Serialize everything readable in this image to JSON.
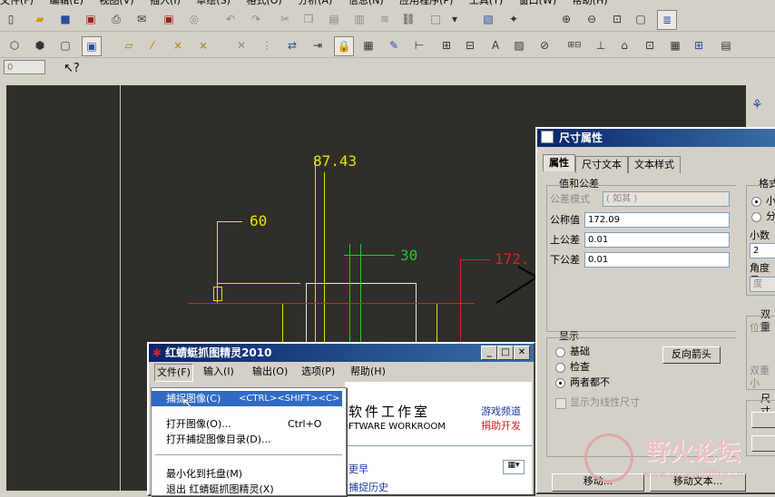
{
  "menubar": {
    "items": [
      "文件(F)",
      "编辑(E)",
      "视图(V)",
      "插入(I)",
      "草绘(S)",
      "格式(O)",
      "分析(A)",
      "信息(N)",
      "应用程序(P)",
      "工具(T)",
      "窗口(W)",
      "帮助(H)"
    ]
  },
  "toolbar_row1": {
    "icons": [
      "new-icon",
      "open-icon",
      "save-icon",
      "print-icon",
      "export-pdf-icon",
      "print-icon",
      "mail-icon",
      "export-pdf-icon",
      "cut-icon",
      "undo-icon",
      "redo-icon",
      "cut-icon",
      "copy-icon",
      "paste-icon",
      "paste-special-icon",
      "find-icon",
      "select-box-icon",
      "dropdown-icon",
      "repaint-icon",
      "zoom-in-icon",
      "zoom-out-icon",
      "zoom-fit-icon",
      "layers-icon"
    ]
  },
  "toolbar_row2": {
    "icons": [
      "shaded-cube-icon",
      "wireframe-cube-icon",
      "hidden-cube-icon",
      "shaded-active-icon",
      "datum-plane-icon",
      "datum-axis-icon",
      "datum-point-icon",
      "csys-icon",
      "delete-icon",
      "dimension-icon",
      "regenerate-icon",
      "switch-icon",
      "lock-icon",
      "table-icon",
      "annotation-icon",
      "ordinate-icon",
      "note-icon",
      "hatch-icon",
      "tolerance-icon",
      "symbol-icon",
      "surface-finish-icon",
      "balloon-icon",
      "bom-icon",
      "grid-icon"
    ]
  },
  "spinbox": {
    "value": "0"
  },
  "drawing": {
    "dim_top": "87.43",
    "dim_left": "60",
    "dim_mid": "30",
    "dim_red": "172."
  },
  "dim_dialog": {
    "title": "尺寸属性",
    "tabs": [
      "属性",
      "尺寸文本",
      "文本样式"
    ],
    "group_value": "值和公差",
    "tol_mode_label": "公差模式",
    "tol_mode_value": "( 如其 )",
    "nominal_label": "公称值",
    "nominal_value": "172.09",
    "upper_label": "上公差",
    "upper_value": "0.01",
    "lower_label": "下公差",
    "lower_value": "0.01",
    "group_format": "格式",
    "format_opt1": "小",
    "format_opt2": "分",
    "decimals_label": "小数位",
    "decimals_value": "2",
    "angle_label": "角度尺",
    "angle_value": "度",
    "group_dual": "双重",
    "dual_pos_label": "位置",
    "dual_sub_label": "双重小",
    "group_display": "显示",
    "display_basic": "基础",
    "display_inspect": "检查",
    "display_neither": "两者都不",
    "reverse_arrow": "反向箭头",
    "linear_check": "显示为线性尺寸",
    "group_dim": "尺寸",
    "move_btn": "移动...",
    "move_text_btn": "移动文本..."
  },
  "capture_window": {
    "title": "红蜻蜓抓图精灵2010",
    "menus": [
      "文件(F)",
      "输入(I)",
      "输出(O)",
      "选项(P)",
      "帮助(H)"
    ],
    "items": [
      {
        "label": "捕捉图像(C)",
        "shortcut": "<CTRL><SHIFT><C>"
      },
      {
        "label": "打开图像(O)...",
        "shortcut": "Ctrl+O"
      },
      {
        "label": "打开捕捉图像目录(D)...",
        "shortcut": ""
      },
      {
        "label": "最小化到托盘(M)",
        "shortcut": ""
      },
      {
        "label": "退出 红蜻蜓抓图精灵(X)",
        "shortcut": ""
      }
    ],
    "banner_cn": "软件工作室",
    "banner_en": "FTWARE WORKROOM",
    "link1": "游戏频道",
    "link2": "捐助开发",
    "link3": "更早",
    "link4": "捕捉历史"
  },
  "watermark": {
    "text": "野火论坛",
    "sub": "www.proewildfire.cn"
  },
  "colors": {
    "canvas": "#2f2e2a",
    "yellow": "#e6e600",
    "red": "#e02020",
    "green": "#20d020",
    "white": "#e8e8e8",
    "titlebar": "#0a246a"
  }
}
